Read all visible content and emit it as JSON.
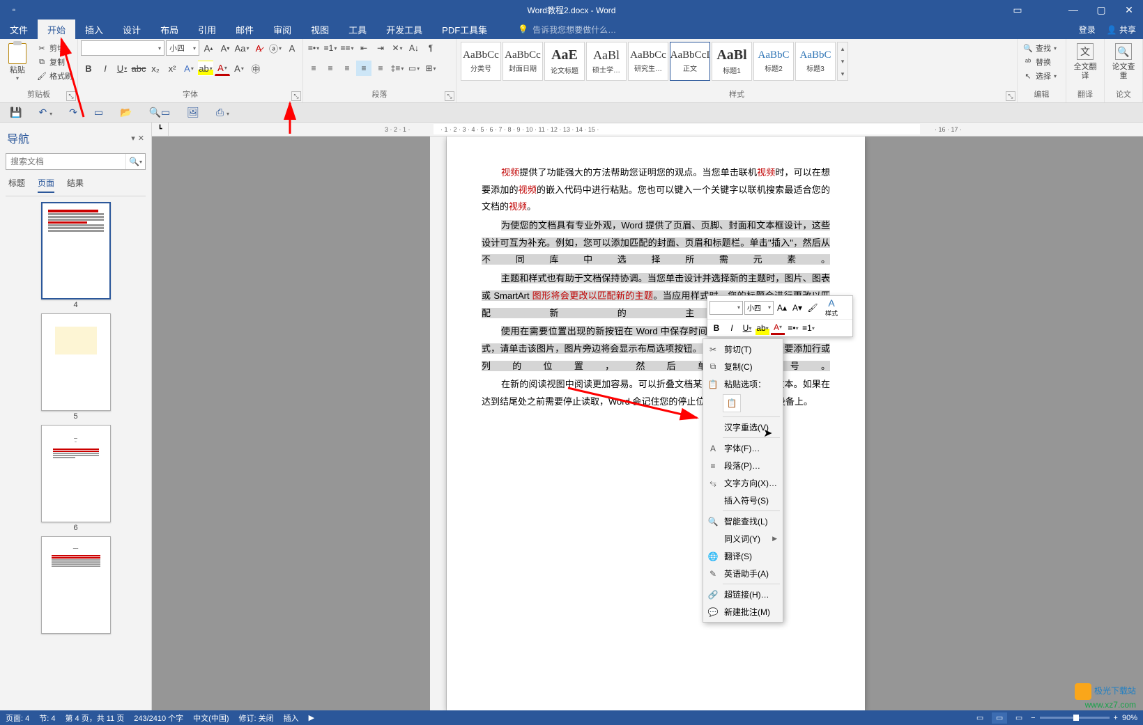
{
  "window": {
    "title": "Word教程2.docx - Word",
    "login": "登录",
    "share": "共享"
  },
  "tabs": {
    "file": "文件",
    "home": "开始",
    "insert": "插入",
    "design": "设计",
    "layout": "布局",
    "references": "引用",
    "mailings": "邮件",
    "review": "审阅",
    "view": "视图",
    "tools": "工具",
    "devtools": "开发工具",
    "pdf": "PDF工具集",
    "tell_me": "告诉我您想要做什么…"
  },
  "ribbon": {
    "clipboard": {
      "label": "剪贴板",
      "paste": "粘贴",
      "cut": "剪切",
      "copy": "复制",
      "format_painter": "格式刷"
    },
    "font": {
      "label": "字体",
      "font_name": "",
      "font_size": "小四"
    },
    "paragraph": {
      "label": "段落"
    },
    "styles": {
      "label": "样式",
      "items": [
        {
          "preview": "AaBbCc",
          "name": "分类号"
        },
        {
          "preview": "AaBbCc",
          "name": "封面日期"
        },
        {
          "preview": "AaE",
          "name": "论文标题"
        },
        {
          "preview": "AaBl",
          "name": "硕士学…"
        },
        {
          "preview": "AaBbCc",
          "name": "研究生…"
        },
        {
          "preview": "AaBbCcI",
          "name": "正文"
        },
        {
          "preview": "AaBl",
          "name": "标题1"
        },
        {
          "preview": "AaBbC",
          "name": "标题2"
        },
        {
          "preview": "AaBbC",
          "name": "标题3"
        }
      ]
    },
    "editing": {
      "label": "编辑",
      "find": "查找",
      "replace": "替换",
      "select": "选择"
    },
    "translate": {
      "label": "翻译",
      "full": "全文翻译"
    },
    "check": {
      "label": "论文",
      "chk": "论文查重"
    }
  },
  "nav": {
    "title": "导航",
    "search_placeholder": "搜索文档",
    "tabs": {
      "headings": "标题",
      "pages": "页面",
      "results": "结果"
    },
    "pages": [
      "4",
      "5",
      "6"
    ]
  },
  "mini_toolbar": {
    "font_size": "小四",
    "styles_label": "样式"
  },
  "context_menu": {
    "cut": "剪切(T)",
    "copy": "复制(C)",
    "paste_options": "粘贴选项：",
    "ime": "汉字重选(V)",
    "font": "字体(F)…",
    "paragraph": "段落(P)…",
    "text_direction": "文字方向(X)…",
    "insert_symbol": "插入符号(S)",
    "smart_lookup": "智能查找(L)",
    "synonyms": "同义词(Y)",
    "translate": "翻译(S)",
    "english_assistant": "英语助手(A)",
    "hyperlink": "超链接(H)…",
    "new_comment": "新建批注(M)"
  },
  "document": {
    "p1_a": "视频",
    "p1_b": "提供了功能强大的方法帮助您证明您的观点。当您单击联机",
    "p1_c": "视频",
    "p1_d": "时，可以在想要添加的",
    "p1_e": "视频",
    "p1_f": "的嵌入代码中进行粘贴。您也可以键入一个关键字以联机搜索最适合您的文档的",
    "p1_g": "视频",
    "p1_h": "。",
    "p2_a": "为使您的文档具有专业外观，Word 提供了页眉、页脚、封面和文本框设计，这些设计可互为补充。例如，您可以添加匹配的封面、页眉和标题栏。单击\"插入\"，然后从不同库中选择所需元素。",
    "p3_a": "主题和样式也有助于文档保持协调。当您单击设计并选择新的主题时，图片、图表或 SmartArt ",
    "p3_b": "图形将会更改以匹配新的主题",
    "p3_c": "。当应用样式时，您的标题会进行更改以匹配新的主题。",
    "p4": "使用在需要位置出现的新按钮在 Word 中保存时间。若要更改图片适应文档的方式，请单击该图片，图片旁边将会显示布局选项按钮。当处理表格时，单击要添加行或列的位置，然后单击加号。",
    "p5": "在新的阅读视图中阅读更加容易。可以折叠文档某些部分并关注所需文本。如果在达到结尾处之前需要停止读取，Word 会记住您的停止位置 - 即使在另一个设备上。"
  },
  "statusbar": {
    "page": "页面: 4",
    "section": "节: 4",
    "page_of": "第 4 页，共 11 页",
    "words": "243/2410 个字",
    "language": "中文(中国)",
    "track": "修订: 关闭",
    "insert": "插入",
    "zoom": "90%"
  },
  "watermark": {
    "name": "极光下载站",
    "url": "www.xz7.com"
  }
}
